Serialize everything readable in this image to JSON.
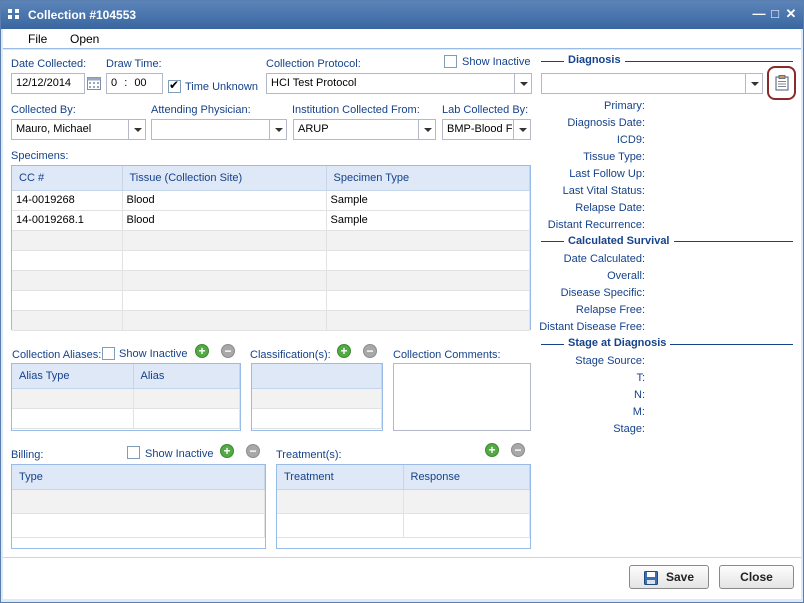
{
  "window": {
    "title": "Collection #104553"
  },
  "menu": {
    "file": "File",
    "open": "Open"
  },
  "collection": {
    "date_label": "Date Collected:",
    "date_value": "12/12/2014",
    "draw_time_label": "Draw Time:",
    "draw_hour": "0",
    "draw_minute": "00",
    "time_unknown_label": "Time Unknown",
    "protocol_label": "Collection Protocol:",
    "protocol_value": "HCI Test Protocol",
    "show_inactive_label": "Show Inactive",
    "collected_by_label": "Collected By:",
    "collected_by_value": "Mauro, Michael",
    "attending_label": "Attending Physician:",
    "attending_value": "",
    "institution_label": "Institution Collected From:",
    "institution_value": "ARUP",
    "lab_label": "Lab Collected By:",
    "lab_value": "BMP-Blood F"
  },
  "specimens": {
    "label": "Specimens:",
    "columns": [
      "CC #",
      "Tissue (Collection Site)",
      "Specimen Type"
    ],
    "rows": [
      [
        "14-0019268",
        "Blood",
        "Sample"
      ],
      [
        "14-0019268.1",
        "Blood",
        "Sample"
      ]
    ]
  },
  "aliases": {
    "label": "Collection Aliases:",
    "show_inactive": "Show Inactive",
    "columns": [
      "Alias Type",
      "Alias"
    ]
  },
  "classifications": {
    "label": "Classification(s):"
  },
  "comments": {
    "label": "Collection Comments:"
  },
  "billing": {
    "label": "Billing:",
    "show_inactive": "Show Inactive",
    "columns": [
      "Type"
    ]
  },
  "treatments": {
    "label": "Treatment(s):",
    "columns": [
      "Treatment",
      "Response"
    ]
  },
  "diagnosis": {
    "title": "Diagnosis",
    "selected": "",
    "fields": [
      "Primary:",
      "Diagnosis Date:",
      "ICD9:",
      "Tissue Type:",
      "Last Follow Up:",
      "Last Vital Status:",
      "Relapse Date:",
      "Distant Recurrence:"
    ]
  },
  "survival": {
    "title": "Calculated Survival",
    "fields": [
      "Date Calculated:",
      "Overall:",
      "Disease Specific:",
      "Relapse Free:",
      "Distant Disease Free:"
    ]
  },
  "stage": {
    "title": "Stage at Diagnosis",
    "fields": [
      "Stage Source:",
      "T:",
      "N:",
      "M:",
      "Stage:"
    ]
  },
  "footer": {
    "save": "Save",
    "close": "Close"
  },
  "colors": {
    "label": "#15428b",
    "titlebar": "#3a66a0",
    "add": "#53a944",
    "highlight": "#8b2a2a"
  },
  "icons": [
    "collection-window-icon",
    "minimize-icon",
    "maximize-icon",
    "close-icon",
    "calendar-icon",
    "clipboard-icon",
    "plus-icon",
    "minus-icon",
    "save-disk-icon",
    "chevron-down-icon"
  ]
}
